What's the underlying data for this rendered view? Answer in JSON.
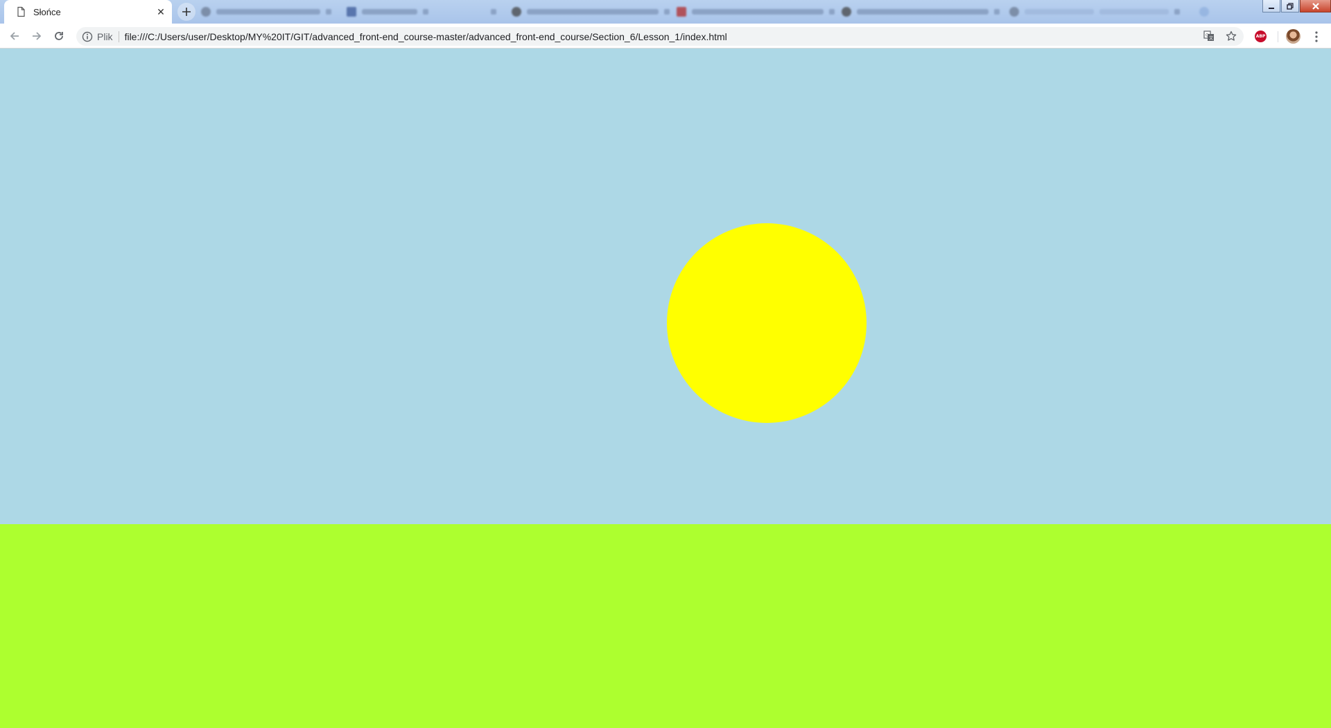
{
  "tabs": {
    "active": {
      "title": "Słońce"
    }
  },
  "toolbar": {
    "scheme_label": "Plik",
    "url": "file:///C:/Users/user/Desktop/MY%20IT/GIT/advanced_front-end_course-master/advanced_front-end_course/Section_6/Lesson_1/index.html",
    "extension_abp_label": "ABP"
  },
  "page": {
    "sky_color": "#add8e6",
    "sun_color": "#ffff00",
    "grass_color": "#adff2f"
  }
}
